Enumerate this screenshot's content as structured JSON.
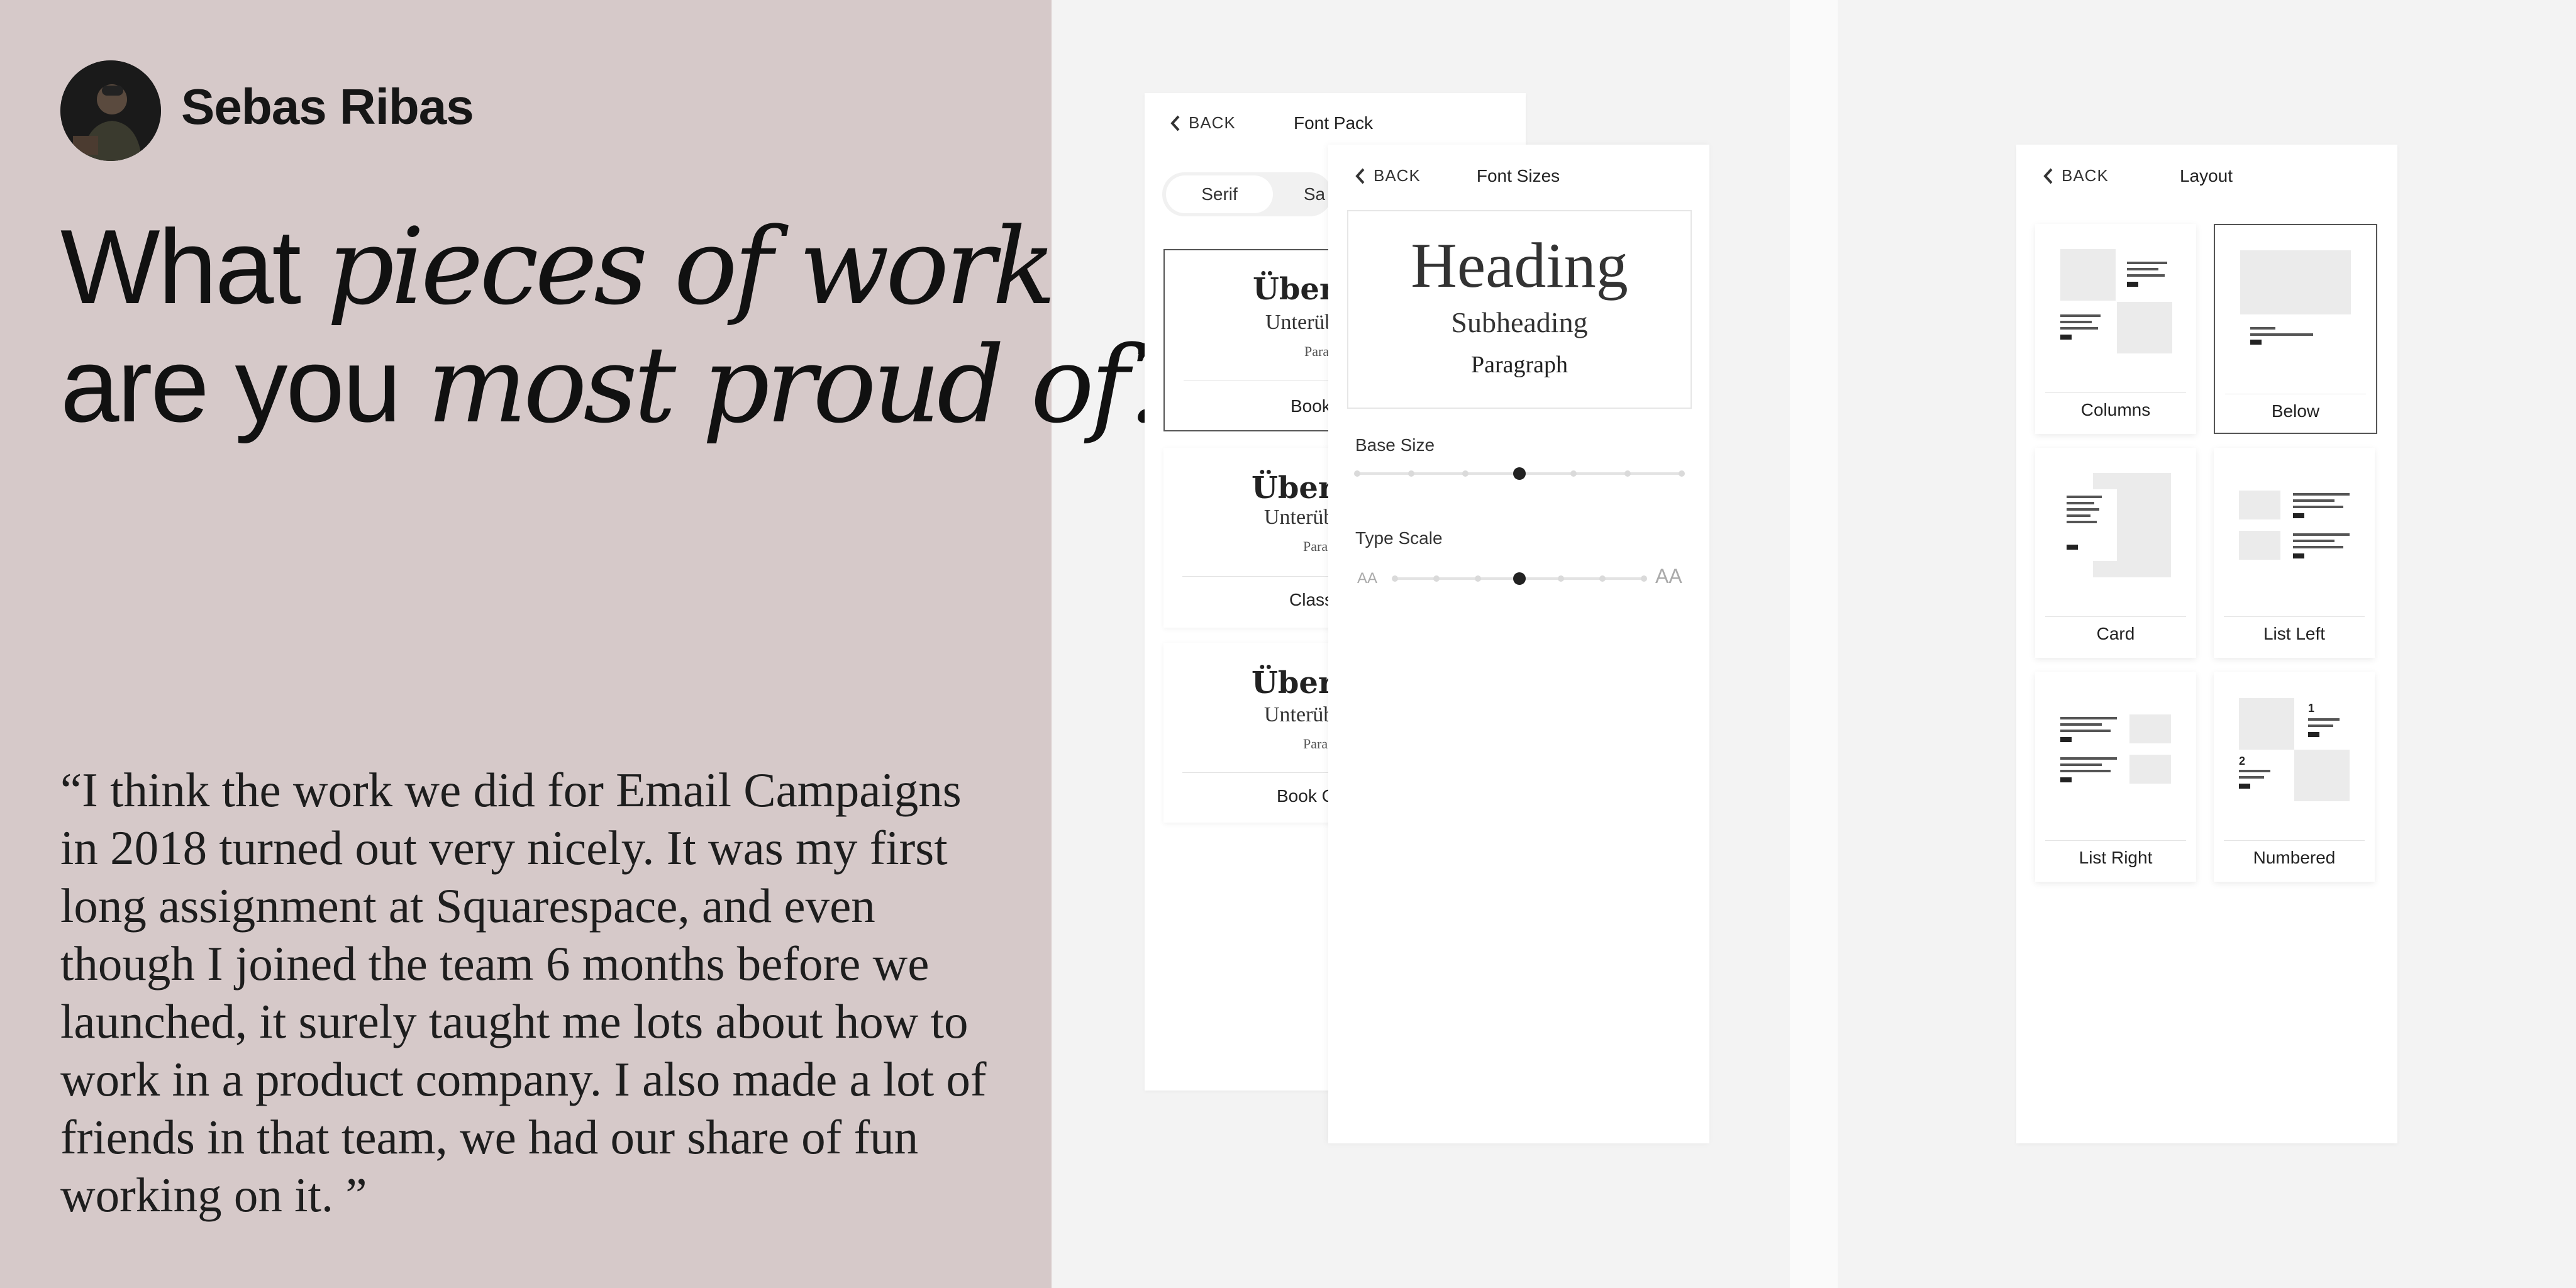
{
  "author": {
    "name": "Sebas Ribas"
  },
  "headline": {
    "line1_plain": "What ",
    "line1_italic": "pieces of work",
    "line2_plain": "are you ",
    "line2_italic": "most proud of?"
  },
  "quote": {
    "lines": [
      "“I think the work we did for Email Campaigns",
      "in 2018 turned out very nicely. It was my first",
      "long assignment at Squarespace, and even",
      "though I joined the team 6 months before we",
      "launched, it surely taught me lots about how to",
      "work in a product company. I also made a lot of",
      "friends in that team, we had our share of fun",
      "working on it. ”"
    ]
  },
  "font_pack": {
    "back_label": "BACK",
    "title": "Font Pack",
    "tabs": [
      "Serif",
      "Sa"
    ],
    "cards": [
      {
        "heading": "Übers",
        "sub": "Unterüb",
        "para": "Paraj",
        "name": "Book",
        "selected": true
      },
      {
        "heading": "Übers",
        "sub": "Unterüb",
        "para": "Para",
        "name": "Class",
        "selected": false
      },
      {
        "heading": "Übers",
        "sub": "Unterüb",
        "para": "Para",
        "name": "Book C",
        "selected": false
      }
    ]
  },
  "font_sizes": {
    "back_label": "BACK",
    "title": "Font Sizes",
    "preview": {
      "heading": "Heading",
      "subheading": "Subheading",
      "paragraph": "Paragraph"
    },
    "base_size": {
      "label": "Base Size",
      "steps": 7,
      "selected_step": 4
    },
    "type_scale": {
      "label": "Type Scale",
      "steps": 7,
      "selected_step": 4,
      "small_icon": "AA",
      "large_icon": "AA"
    }
  },
  "layout": {
    "back_label": "BACK",
    "title": "Layout",
    "options": [
      {
        "name": "Columns",
        "selected": false
      },
      {
        "name": "Below",
        "selected": true
      },
      {
        "name": "Card",
        "selected": false
      },
      {
        "name": "List Left",
        "selected": false
      },
      {
        "name": "List Right",
        "selected": false
      },
      {
        "name": "Numbered",
        "selected": false,
        "numbers": [
          "1",
          "2"
        ]
      }
    ]
  },
  "colors": {
    "left_panel_bg": "#d6c9c9",
    "page_bg": "#f3f3f3",
    "knob": "#222222",
    "placeholder": "#ebebeb",
    "text_bar": "#555555"
  }
}
